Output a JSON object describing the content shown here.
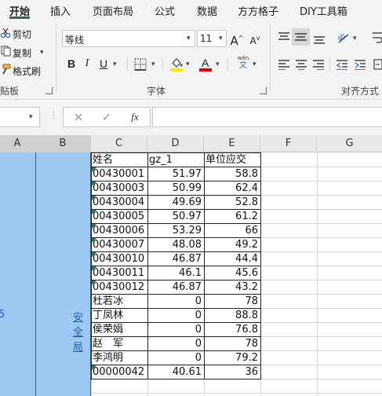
{
  "tabs": [
    "开始",
    "插入",
    "页面布局",
    "公式",
    "数据",
    "方方格子",
    "DIY工具箱"
  ],
  "clipboard": {
    "cut": "剪切",
    "copy": "复制",
    "format_painter": "格式刷",
    "group_label": "贴板"
  },
  "font": {
    "name": "等线",
    "size": "11",
    "grow": "A",
    "shrink": "A",
    "bold": "B",
    "italic": "I",
    "underline": "U",
    "group_label": "字体",
    "phonetic_top": "wén",
    "phonetic_bottom": "文"
  },
  "alignment": {
    "group_label": "对齐方式"
  },
  "formula_bar": {
    "cancel": "×",
    "enter": "✓",
    "fx": "fx",
    "value": ""
  },
  "columns": [
    "A",
    "B",
    "C",
    "D",
    "E",
    "F",
    "G"
  ],
  "merged": {
    "a_text": "5",
    "b_text": "安全局"
  },
  "table": {
    "headers": [
      "姓名",
      "gz_1",
      "单位应交"
    ],
    "rows": [
      [
        "00430001",
        "51.97",
        "58.8"
      ],
      [
        "00430003",
        "50.99",
        "62.4"
      ],
      [
        "00430004",
        "49.69",
        "52.8"
      ],
      [
        "00430005",
        "50.97",
        "61.2"
      ],
      [
        "00430006",
        "53.29",
        "66"
      ],
      [
        "00430007",
        "48.08",
        "49.2"
      ],
      [
        "00430010",
        "46.87",
        "44.4"
      ],
      [
        "00430011",
        "46.1",
        "45.6"
      ],
      [
        "00430012",
        "46.87",
        "43.2"
      ],
      [
        "杜若冰",
        "0",
        "78"
      ],
      [
        "丁凤林",
        "0",
        "88.8"
      ],
      [
        "侯荣娟",
        "0",
        "76.8"
      ],
      [
        "赵　军",
        "0",
        "78"
      ],
      [
        "李鸿明",
        "0",
        "79.2"
      ],
      [
        "00000042",
        "40.61",
        "36"
      ]
    ]
  },
  "colors": {
    "accent": "#217346",
    "selection": "#9cc8f2",
    "link": "#1f5fb5"
  }
}
